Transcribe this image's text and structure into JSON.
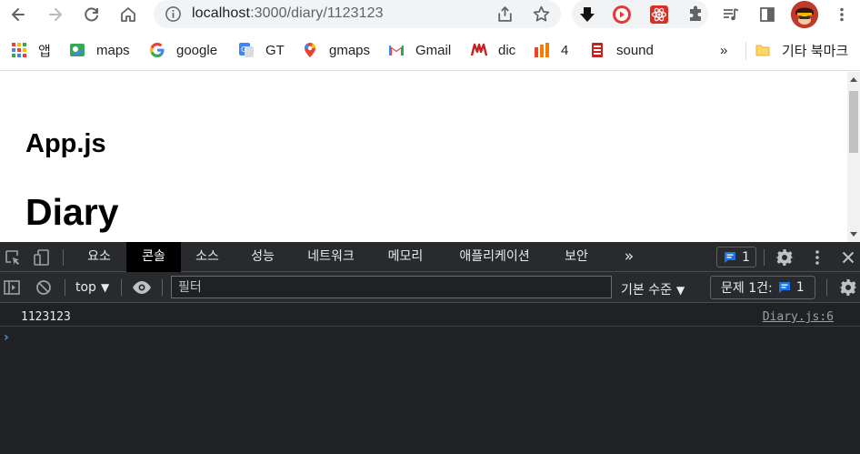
{
  "browser": {
    "url_host": "localhost",
    "url_path": ":3000/diary/1123123",
    "bookmarks": [
      {
        "label": "앱",
        "icon": "apps-grid-icon"
      },
      {
        "label": "maps",
        "icon": "maps-icon"
      },
      {
        "label": "google",
        "icon": "google-icon"
      },
      {
        "label": "GT",
        "icon": "translate-icon"
      },
      {
        "label": "gmaps",
        "icon": "map-pin-icon"
      },
      {
        "label": "Gmail",
        "icon": "gmail-icon"
      },
      {
        "label": "dic",
        "icon": "dictionary-icon"
      },
      {
        "label": "4",
        "icon": "office-icon"
      },
      {
        "label": "sound",
        "icon": "sound-icon"
      }
    ],
    "overflow_label": "»",
    "other_bookmarks": "기타 북마크"
  },
  "page": {
    "app_heading": "App.js",
    "diary_heading": "Diary"
  },
  "devtools": {
    "tabs": [
      "요소",
      "콘솔",
      "소스",
      "성능",
      "네트워크",
      "메모리",
      "애플리케이션",
      "보안"
    ],
    "active_tab": "콘솔",
    "more_tabs": "»",
    "issues_count": "1",
    "context": "top",
    "filter_placeholder": "필터",
    "levels_label": "기본 수준",
    "issues_label": "문제 1건:",
    "issues_badge_count": "1",
    "log": {
      "message": "1123123",
      "source": "Diary.js:6"
    },
    "prompt_symbol": "›"
  },
  "colors": {
    "devtools_bg": "#202124",
    "devtools_bar": "#292a2d",
    "accent_blue": "#1a73e8",
    "avatar_red": "#c5221f"
  }
}
